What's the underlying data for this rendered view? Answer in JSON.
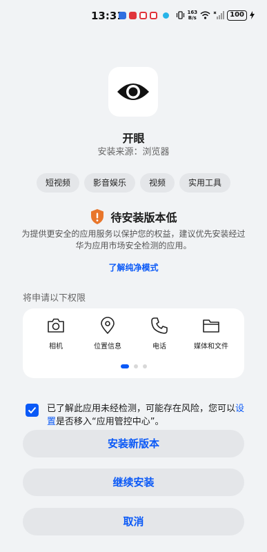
{
  "status_bar": {
    "time": "13:31",
    "net_speed_value": "163",
    "net_speed_unit": "B/s",
    "battery": "100"
  },
  "app": {
    "name": "开眼",
    "source": "安装来源：浏览器",
    "icon": "eye-icon"
  },
  "tags": [
    "短视频",
    "影音娱乐",
    "视频",
    "实用工具"
  ],
  "warning": {
    "title": "待安装版本低",
    "description": "为提供更安全的应用服务以保护您的权益，建议优先安装经过华为应用市场安全检测的应用。",
    "link": "了解纯净模式",
    "icon": "shield-warning-icon",
    "color": "#e8762c"
  },
  "permissions": {
    "heading": "将申请以下权限",
    "items": [
      {
        "label": "相机",
        "icon": "camera-icon"
      },
      {
        "label": "位置信息",
        "icon": "location-icon"
      },
      {
        "label": "电话",
        "icon": "phone-icon"
      },
      {
        "label": "媒体和文件",
        "icon": "folder-icon"
      }
    ],
    "page_count": 3,
    "active_page": 1
  },
  "consent": {
    "checked": true,
    "text_before": "已了解此应用未经检测，可能存在风险，您可以",
    "link": "设置",
    "text_after": "是否移入“应用管控中心”。"
  },
  "buttons": {
    "install_new": "安装新版本",
    "continue": "继续安装",
    "cancel": "取消"
  },
  "colors": {
    "accent": "#0a59f7",
    "background": "#f1f3f5",
    "warning": "#e8762c"
  }
}
